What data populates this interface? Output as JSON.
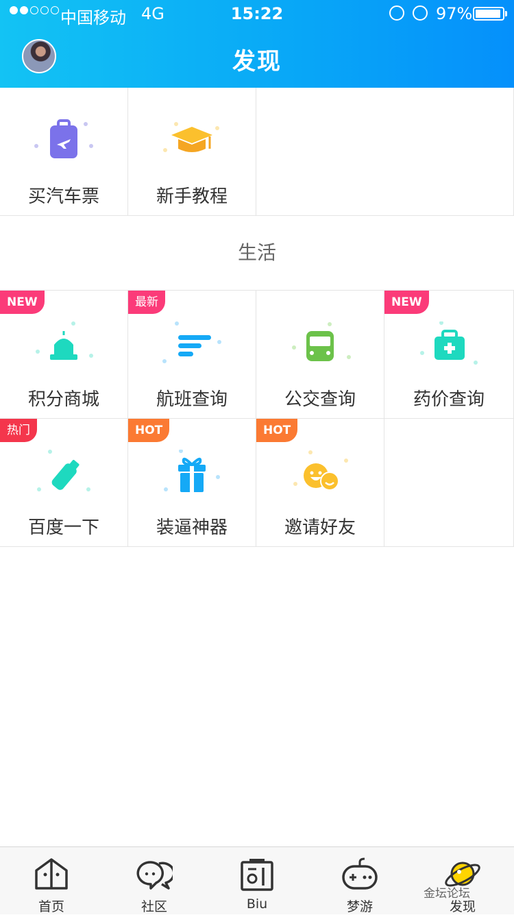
{
  "status_bar": {
    "carrier": "中国移动",
    "network": "4G",
    "time": "15:22",
    "battery": "97%"
  },
  "header": {
    "title": "发现"
  },
  "top_items": [
    {
      "label": "买汽车票",
      "icon": "luggage-icon"
    },
    {
      "label": "新手教程",
      "icon": "graduation-cap-icon"
    }
  ],
  "section_title": "生活",
  "life_items": [
    {
      "label": "积分商城",
      "badge": "NEW",
      "icon": "alarm-light-icon"
    },
    {
      "label": "航班查询",
      "badge": "最新",
      "icon": "lines-icon"
    },
    {
      "label": "公交查询",
      "badge": "",
      "icon": "bus-icon"
    },
    {
      "label": "药价查询",
      "badge": "NEW",
      "icon": "medkit-icon"
    },
    {
      "label": "百度一下",
      "badge": "热门",
      "icon": "bottle-icon"
    },
    {
      "label": "装逼神器",
      "badge": "HOT",
      "icon": "gift-icon"
    },
    {
      "label": "邀请好友",
      "badge": "HOT",
      "icon": "smiley-icon"
    }
  ],
  "tabs": [
    {
      "label": "首页",
      "icon": "home-icon"
    },
    {
      "label": "社区",
      "icon": "chat-icon"
    },
    {
      "label": "Biu",
      "icon": "biu-icon"
    },
    {
      "label": "梦游",
      "icon": "gamepad-icon"
    },
    {
      "label": "发现",
      "icon": "planet-icon",
      "active": true
    }
  ],
  "watermark": "金坛论坛",
  "colors": {
    "header": "#08a6f7",
    "new_badge": "#fb3b79",
    "hot_badge": "#fb7a33",
    "teal": "#1ed9bf"
  }
}
